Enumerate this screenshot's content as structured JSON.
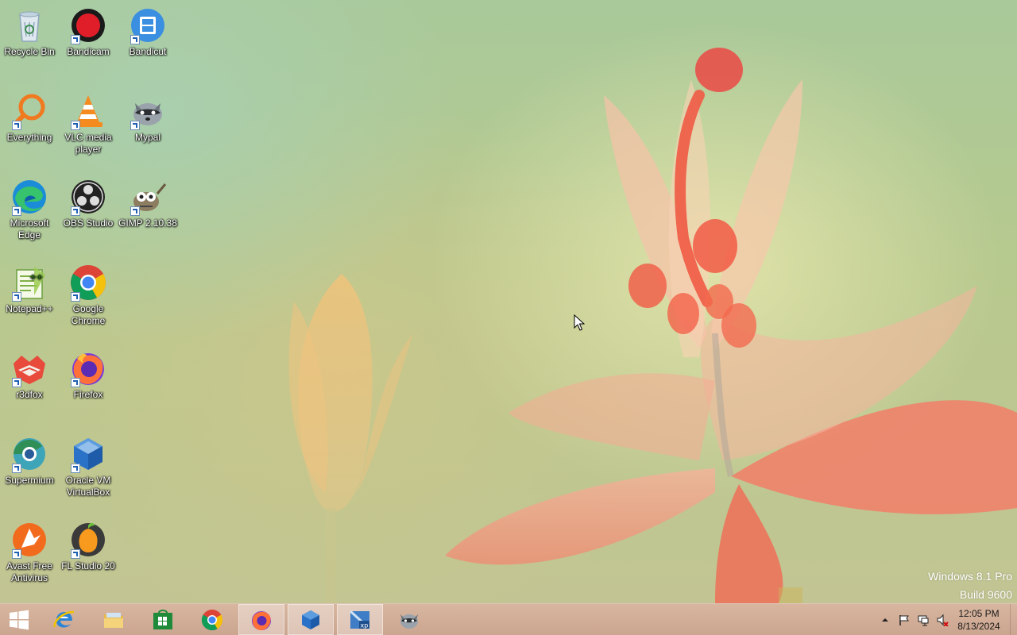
{
  "desktop": {
    "icons": [
      {
        "label": "Recycle Bin",
        "icon": "recycle-bin-icon"
      },
      {
        "label": "Bandicam",
        "icon": "bandicam-icon"
      },
      {
        "label": "Bandicut",
        "icon": "bandicut-icon"
      },
      {
        "label": "Everything",
        "icon": "everything-search-icon"
      },
      {
        "label": "VLC media player",
        "icon": "vlc-icon"
      },
      {
        "label": "Mypal",
        "icon": "mypal-raccoon-icon"
      },
      {
        "label": "Microsoft Edge",
        "icon": "edge-icon"
      },
      {
        "label": "OBS Studio",
        "icon": "obs-icon"
      },
      {
        "label": "GIMP 2.10.38",
        "icon": "gimp-icon"
      },
      {
        "label": "Notepad++",
        "icon": "notepad-plus-plus-icon"
      },
      {
        "label": "Google Chrome",
        "icon": "chrome-icon"
      },
      {
        "label": "r3dfox",
        "icon": "r3dfox-icon"
      },
      {
        "label": "Firefox",
        "icon": "firefox-icon"
      },
      {
        "label": "Supermium",
        "icon": "supermium-icon"
      },
      {
        "label": "Oracle VM VirtualBox",
        "icon": "virtualbox-icon"
      },
      {
        "label": "Avast Free Antivirus",
        "icon": "avast-icon"
      },
      {
        "label": "FL Studio 20",
        "icon": "fl-studio-icon"
      }
    ]
  },
  "watermark": {
    "line1": "Windows 8.1 Pro",
    "line2": "Build 9600"
  },
  "taskbar": {
    "start": "windows-start-icon",
    "apps": [
      {
        "icon": "internet-explorer-icon",
        "active": false
      },
      {
        "icon": "file-explorer-icon",
        "active": false
      },
      {
        "icon": "windows-store-icon",
        "active": false
      },
      {
        "icon": "chrome-icon",
        "active": false
      },
      {
        "icon": "firefox-icon",
        "active": true
      },
      {
        "icon": "virtualbox-icon",
        "active": true
      },
      {
        "icon": "windows-xp-vm-icon",
        "active": true
      },
      {
        "icon": "mypal-raccoon-icon",
        "active": false
      }
    ],
    "tray": {
      "time": "12:05 PM",
      "date": "8/13/2024"
    }
  },
  "colors": {
    "taskbar": "#d2ab94",
    "wallpaper_green": "#b7c98e",
    "flower_coral": "#f07a62"
  }
}
